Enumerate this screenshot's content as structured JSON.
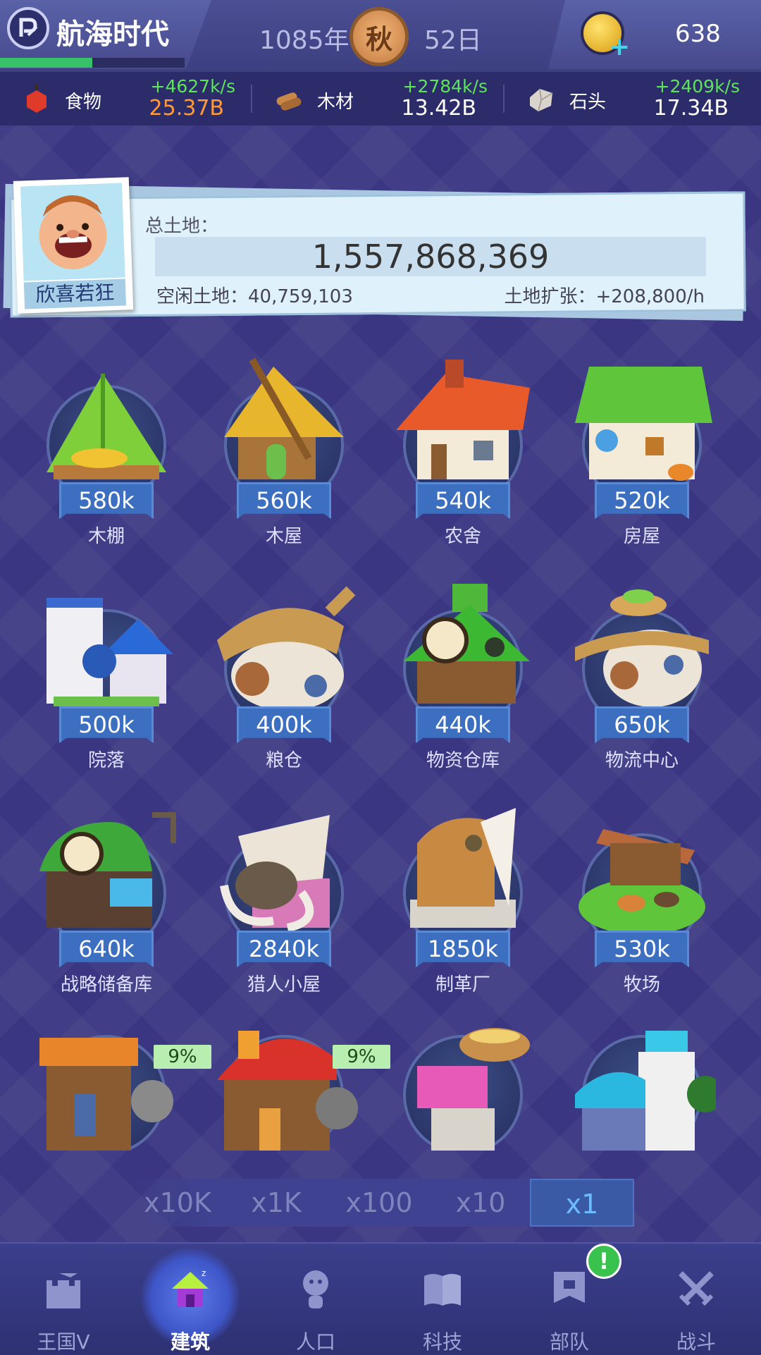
{
  "header": {
    "game_title": "航海时代",
    "year": "1085年",
    "season": "秋",
    "day": "52日",
    "coins": "638",
    "xp_fraction": 0.5
  },
  "resources": [
    {
      "name": "食物",
      "rate": "+4627k/s",
      "amount": "25.37B",
      "icon": "apple-icon"
    },
    {
      "name": "木材",
      "rate": "+2784k/s",
      "amount": "13.42B",
      "icon": "wood-log-icon"
    },
    {
      "name": "石头",
      "rate": "+2409k/s",
      "amount": "17.34B",
      "icon": "stone-icon"
    }
  ],
  "land": {
    "total_label": "总土地：",
    "total_value": "1,557,868,369",
    "free_label": "空闲土地：",
    "free_value": "40,759,103",
    "expand_label": "土地扩张：",
    "expand_value": "+208,800/h"
  },
  "player": {
    "name": "欣喜若狂"
  },
  "buildings": [
    {
      "name": "木棚",
      "cost": "580k"
    },
    {
      "name": "木屋",
      "cost": "560k"
    },
    {
      "name": "农舍",
      "cost": "540k"
    },
    {
      "name": "房屋",
      "cost": "520k"
    },
    {
      "name": "院落",
      "cost": "500k"
    },
    {
      "name": "粮仓",
      "cost": "400k"
    },
    {
      "name": "物资仓库",
      "cost": "440k"
    },
    {
      "name": "物流中心",
      "cost": "650k"
    },
    {
      "name": "战略储备库",
      "cost": "640k"
    },
    {
      "name": "猎人小屋",
      "cost": "2840k"
    },
    {
      "name": "制革厂",
      "cost": "1850k"
    },
    {
      "name": "牧场",
      "cost": "530k"
    }
  ],
  "partial_buildings": [
    {
      "badge": "9%"
    },
    {
      "badge": "9%"
    }
  ],
  "multipliers": [
    "x10K",
    "x1K",
    "x100",
    "x10",
    "x1"
  ],
  "selected_multiplier": "x1",
  "nav": [
    {
      "label": "王国V",
      "icon": "castle-icon"
    },
    {
      "label": "建筑",
      "icon": "house-icon"
    },
    {
      "label": "人口",
      "icon": "person-icon"
    },
    {
      "label": "科技",
      "icon": "book-icon"
    },
    {
      "label": "部队",
      "icon": "banner-icon"
    },
    {
      "label": "战斗",
      "icon": "crossed-swords-icon"
    }
  ],
  "nav_alert": "!",
  "colors": {
    "background": "#3a3682",
    "cost_badge": "#3d6fc0",
    "rate_green": "#5ee35c",
    "food_amount": "#ff9a3a"
  }
}
